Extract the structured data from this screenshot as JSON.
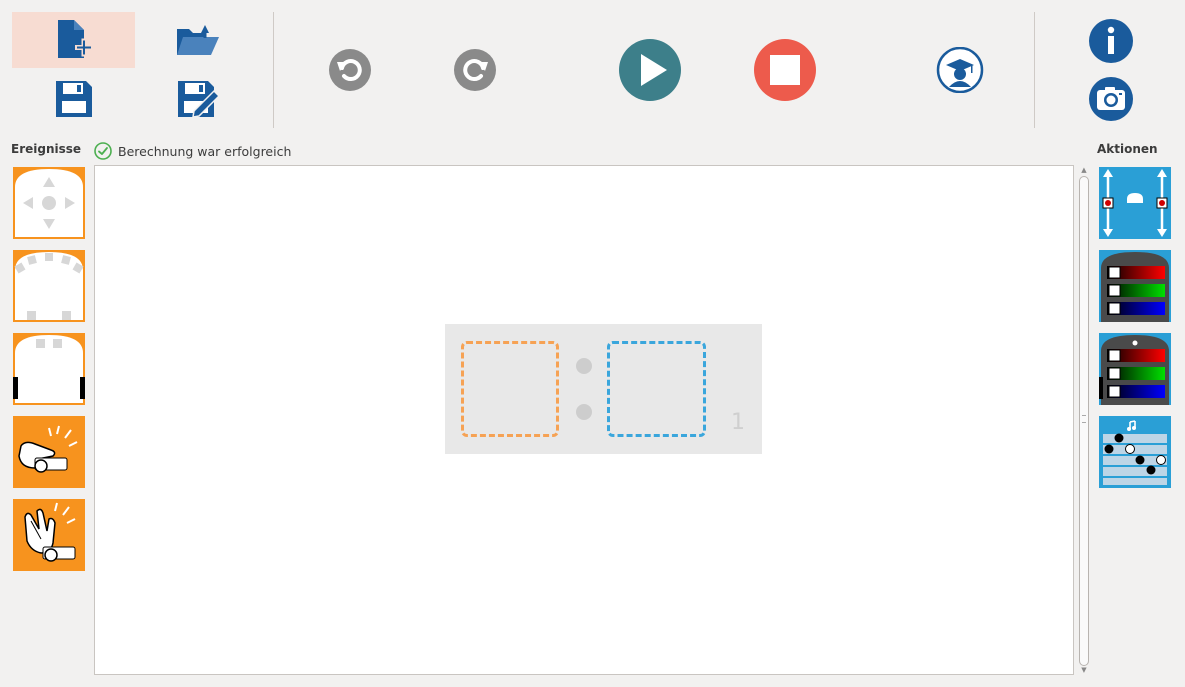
{
  "toolbar": {
    "new": {
      "icon": "new-file-icon",
      "active": true
    },
    "open": {
      "icon": "open-folder-icon"
    },
    "save": {
      "icon": "save-icon"
    },
    "save_as": {
      "icon": "save-as-icon"
    },
    "undo": {
      "icon": "undo-icon"
    },
    "redo": {
      "icon": "redo-icon"
    },
    "run": {
      "icon": "play-icon"
    },
    "stop": {
      "icon": "stop-icon"
    },
    "advanced": {
      "icon": "graduation-cap-icon"
    },
    "about": {
      "icon": "info-icon"
    },
    "screenshot": {
      "icon": "camera-icon"
    }
  },
  "events_panel": {
    "title": "Ereignisse",
    "blocks": [
      {
        "icon": "buttons-event-icon"
      },
      {
        "icon": "front-prox-event-icon"
      },
      {
        "icon": "ground-prox-event-icon"
      },
      {
        "icon": "tap-event-icon"
      },
      {
        "icon": "clap-event-icon"
      }
    ]
  },
  "status": {
    "icon": "check-circle-icon",
    "text": "Berechnung war erfolgreich"
  },
  "program": {
    "pair_number": "1"
  },
  "actions_panel": {
    "title": "Aktionen",
    "blocks": [
      {
        "icon": "motors-action-icon"
      },
      {
        "icon": "top-colors-action-icon"
      },
      {
        "icon": "bottom-colors-action-icon"
      },
      {
        "icon": "music-action-icon"
      }
    ]
  },
  "colors": {
    "accent_orange": "#f7931e",
    "accent_blue": "#2a9fd6",
    "toolbar_blue": "#1a5b9c",
    "run_teal": "#3d7f8a",
    "stop_red": "#ed5b4c",
    "success_green": "#4caf50"
  }
}
